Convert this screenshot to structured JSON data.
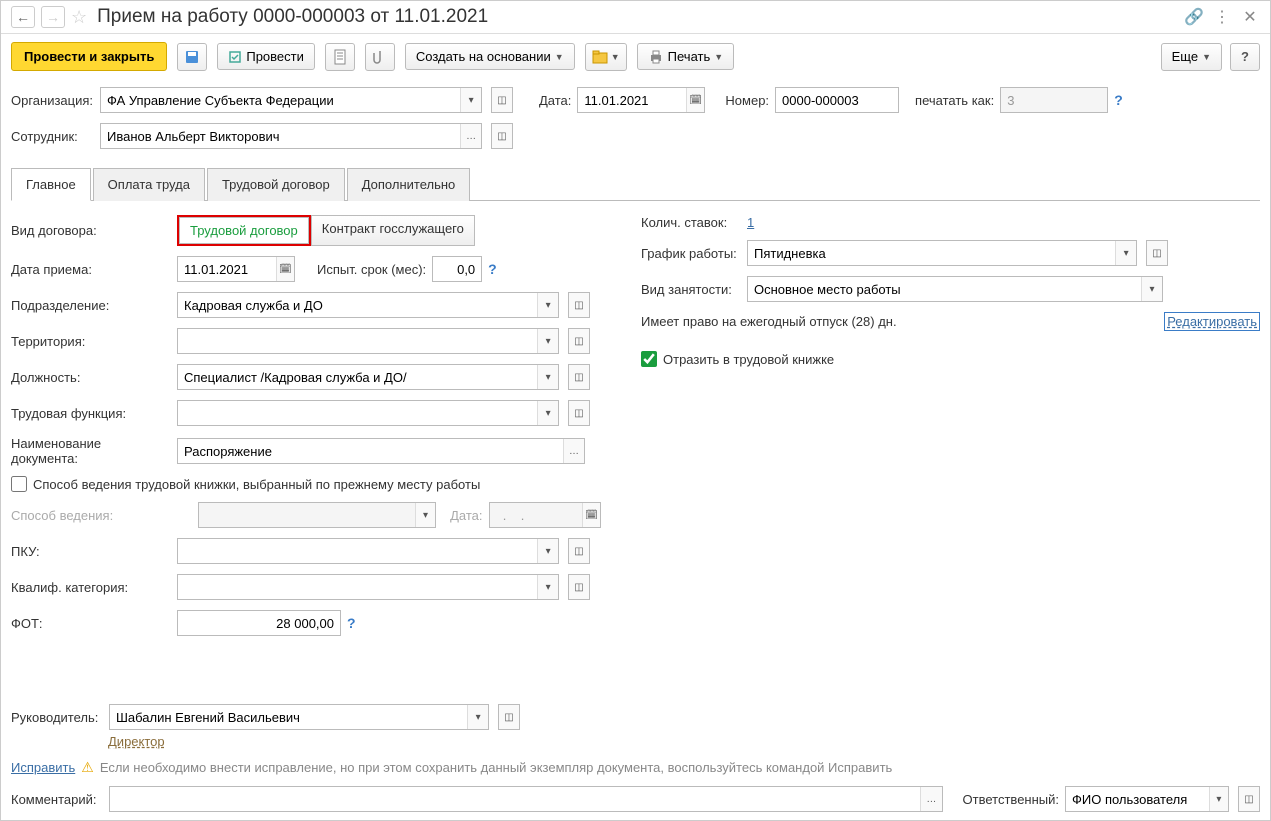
{
  "header": {
    "title": "Прием на работу 0000-000003 от 11.01.2021"
  },
  "toolbar": {
    "post_close": "Провести и закрыть",
    "post": "Провести",
    "create_based": "Создать на основании",
    "print": "Печать",
    "more": "Еще"
  },
  "top": {
    "org_label": "Организация:",
    "org_value": "ФА Управление Субъекта Федерации",
    "date_label": "Дата:",
    "date_value": "11.01.2021",
    "num_label": "Номер:",
    "num_value": "0000-000003",
    "print_as_label": "печатать как:",
    "print_as_value": "3",
    "emp_label": "Сотрудник:",
    "emp_value": "Иванов Альберт Викторович"
  },
  "tabs": [
    "Главное",
    "Оплата труда",
    "Трудовой договор",
    "Дополнительно"
  ],
  "left": {
    "contract_type_label": "Вид договора:",
    "contract_type_opts": [
      "Трудовой договор",
      "Контракт госслужащего"
    ],
    "hire_date_label": "Дата приема:",
    "hire_date_value": "11.01.2021",
    "trial_label": "Испыт. срок (мес):",
    "trial_value": "0,0",
    "dept_label": "Подразделение:",
    "dept_value": "Кадровая служба и ДО",
    "territory_label": "Территория:",
    "territory_value": "",
    "position_label": "Должность:",
    "position_value": "Специалист /Кадровая служба и ДО/",
    "func_label": "Трудовая функция:",
    "func_value": "",
    "docname_label": "Наименование документа:",
    "docname_value": "Распоряжение",
    "prev_book_label": "Способ ведения трудовой книжки, выбранный по прежнему месту работы",
    "method_label": "Способ ведения:",
    "method_date_label": "Дата:",
    "method_date_value": "  .    .",
    "pku_label": "ПКУ:",
    "qual_label": "Квалиф. категория:",
    "fot_label": "ФОТ:",
    "fot_value": "28 000,00"
  },
  "right": {
    "rate_label": "Колич. ставок:",
    "rate_value": "1",
    "schedule_label": "График работы:",
    "schedule_value": "Пятидневка",
    "emp_type_label": "Вид занятости:",
    "emp_type_value": "Основное место работы",
    "vacation_text": "Имеет право на ежегодный отпуск (28) дн.",
    "edit_link": "Редактировать",
    "book_checkbox": "Отразить в трудовой книжке"
  },
  "bottom": {
    "manager_label": "Руководитель:",
    "manager_value": "Шабалин Евгений Васильевич",
    "manager_pos": "Директор",
    "correct_link": "Исправить",
    "correct_hint": "Если необходимо внести исправление, но при этом сохранить данный экземпляр документа, воспользуйтесь командой Исправить",
    "comment_label": "Комментарий:",
    "responsible_label": "Ответственный:",
    "responsible_value": "ФИО пользователя"
  }
}
